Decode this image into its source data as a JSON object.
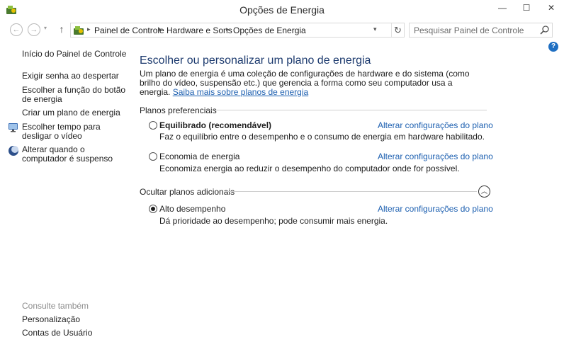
{
  "window": {
    "title": "Opções de Energia",
    "minimize": "—",
    "maximize": "☐",
    "close": "✕"
  },
  "nav": {
    "back": "←",
    "forward": "→",
    "recent": "▾",
    "up": "↑",
    "breadcrumb": [
      "Painel de Controle",
      "Hardware e Sons",
      "Opções de Energia"
    ],
    "separator": "▸",
    "dropdown": "▾",
    "refresh": "↻"
  },
  "search": {
    "placeholder": "Pesquisar Painel de Controle"
  },
  "help": "?",
  "sidebar": {
    "items": [
      {
        "label": "Início do Painel de Controle",
        "icon": null
      },
      {
        "label": "Exigir senha ao despertar",
        "icon": null
      },
      {
        "label": "Escolher a função do botão de energia",
        "icon": null
      },
      {
        "label": "Criar um plano de energia",
        "icon": null
      },
      {
        "label": "Escolher tempo para desligar o vídeo",
        "icon": "monitor-power-icon"
      },
      {
        "label": "Alterar quando o computador é suspenso",
        "icon": "moon-sleep-icon"
      }
    ],
    "see_also": {
      "title": "Consulte também",
      "links": [
        "Personalização",
        "Contas de Usuário"
      ]
    }
  },
  "main": {
    "title": "Escolher ou personalizar um plano de energia",
    "description": "Um plano de energia é uma coleção de configurações de hardware e do sistema (como brilho do vídeo, suspensão etc.) que gerencia a forma como seu computador usa a energia.",
    "learn_more": "Saiba mais sobre planos de energia",
    "preferred_heading": "Planos preferenciais",
    "hidden_heading": "Ocultar planos adicionais",
    "collapse_glyph": "︿",
    "plans": [
      {
        "name": "Equilibrado (recomendável)",
        "desc": "Faz o equilíbrio entre o desempenho e o consumo de energia em hardware habilitado.",
        "link": "Alterar configurações do plano",
        "selected": false
      },
      {
        "name": "Economia de energia",
        "desc": "Economiza energia ao reduzir o desempenho do computador onde for possível.",
        "link": "Alterar configurações do plano",
        "selected": false
      },
      {
        "name": "Alto desempenho",
        "desc": "Dá prioridade ao desempenho; pode consumir mais energia.",
        "link": "Alterar configurações do plano",
        "selected": true
      }
    ]
  },
  "colors": {
    "link": "#1c5fb0",
    "title": "#1c3a6e"
  }
}
